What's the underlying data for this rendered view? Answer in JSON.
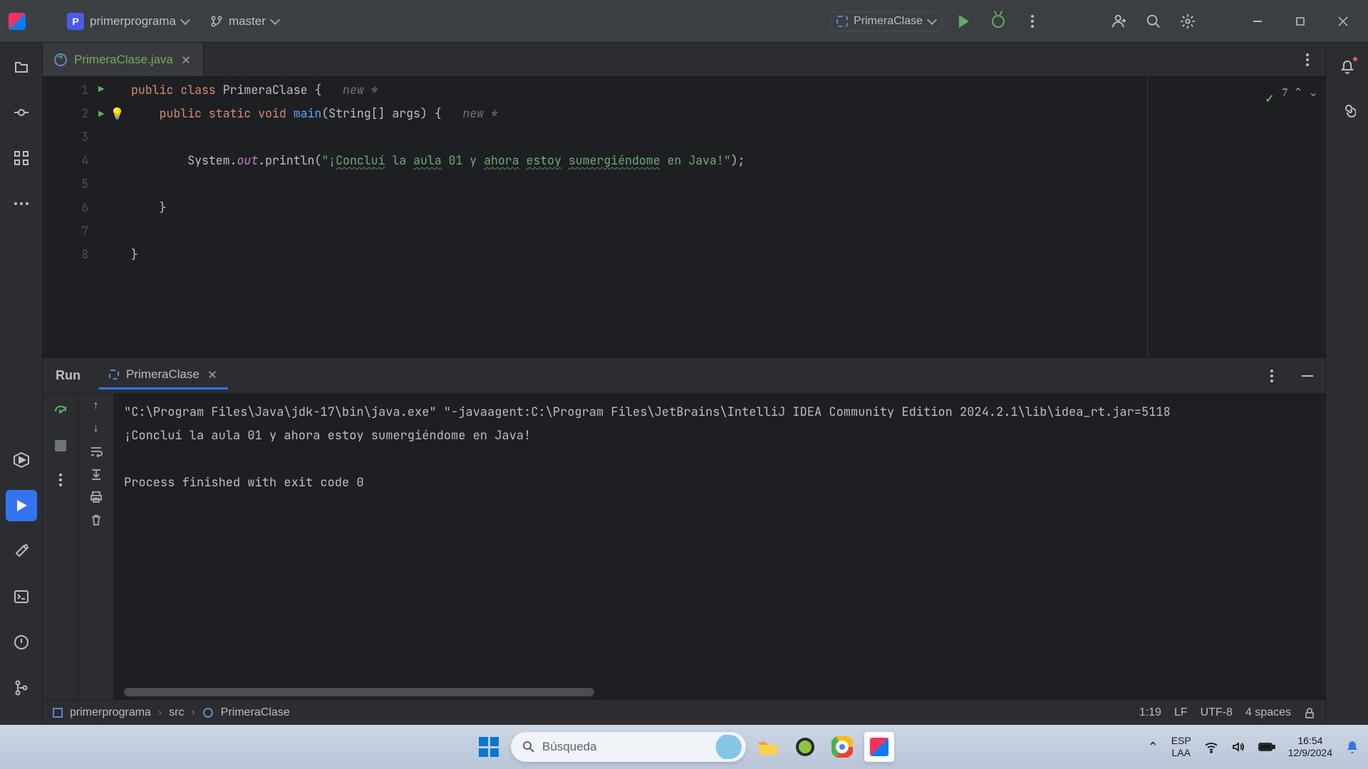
{
  "titlebar": {
    "project_initial": "P",
    "project_name": "primerprograma",
    "branch_name": "master",
    "run_config_name": "PrimeraClase"
  },
  "editor": {
    "tab_name": "PrimeraClase.java",
    "line_numbers": [
      "1",
      "2",
      "3",
      "4",
      "5",
      "6",
      "7",
      "8"
    ],
    "code": {
      "l1_kw1": "public",
      "l1_kw2": "class",
      "l1_cls": "PrimeraClase",
      "l1_brace": " {",
      "l1_hint": "new *",
      "l2_kw": "public static void",
      "l2_meth": "main",
      "l2_sig": "(String[] args) {",
      "l2_hint": "new *",
      "l4_prefix": "System.",
      "l4_out": "out",
      "l4_print": ".println(",
      "l4_str_open": "\"¡",
      "l4_w1": "Concluí",
      "l4_sp1": " la ",
      "l4_w2": "aula",
      "l4_sp2": " 01 y ",
      "l4_w3": "ahora",
      "l4_sp3": " ",
      "l4_w4": "estoy",
      "l4_sp4": " ",
      "l4_w5": "sumergiéndome",
      "l4_rest": " en Java!\"",
      "l4_end": ");",
      "l6": "    }",
      "l8": "}"
    },
    "inspection": {
      "count": "7"
    }
  },
  "run": {
    "title": "Run",
    "tab_name": "PrimeraClase",
    "output_l1": "\"C:\\Program Files\\Java\\jdk-17\\bin\\java.exe\" \"-javaagent:C:\\Program Files\\JetBrains\\IntelliJ IDEA Community Edition 2024.2.1\\lib\\idea_rt.jar=5118",
    "output_l2": "¡Concluí la aula 01 y ahora estoy sumergiéndome en Java!",
    "output_l4": "Process finished with exit code 0"
  },
  "status": {
    "crumb1": "primerprograma",
    "crumb2": "src",
    "crumb3": "PrimeraClase",
    "pos": "1:19",
    "le": "LF",
    "enc": "UTF-8",
    "indent": "4 spaces"
  },
  "taskbar": {
    "search_placeholder": "Búsqueda",
    "lang1": "ESP",
    "lang2": "LAA",
    "time": "16:54",
    "date": "12/9/2024"
  }
}
